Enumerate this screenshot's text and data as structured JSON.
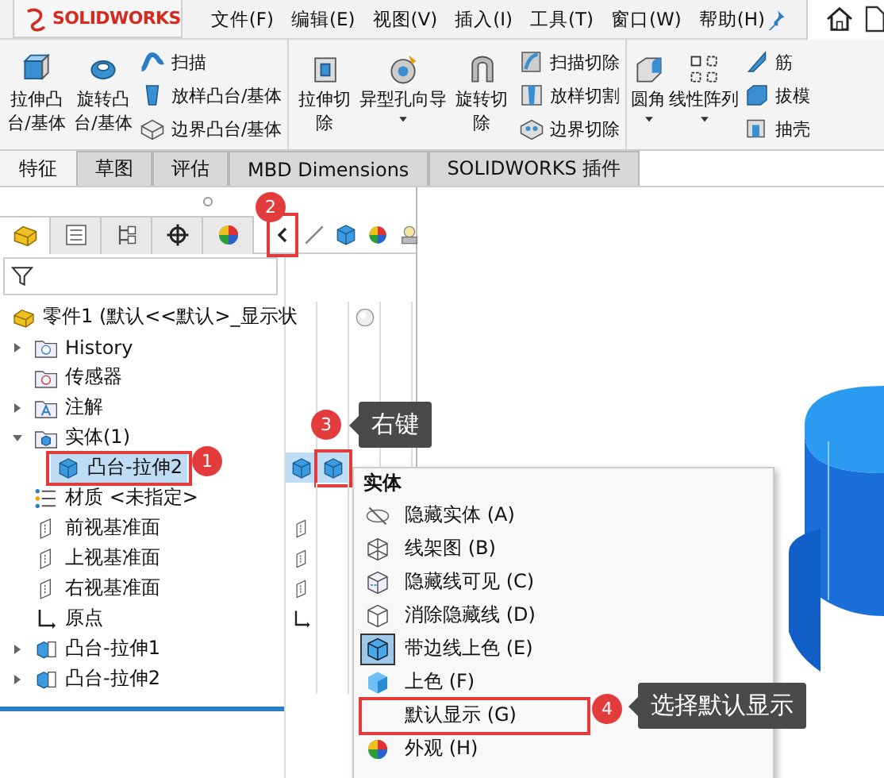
{
  "app": {
    "logo": "SOLIDWORKS"
  },
  "menu_bar": [
    {
      "label": "文件(F)"
    },
    {
      "label": "编辑(E)"
    },
    {
      "label": "视图(V)"
    },
    {
      "label": "插入(I)"
    },
    {
      "label": "工具(T)"
    },
    {
      "label": "窗口(W)"
    },
    {
      "label": "帮助(H)"
    }
  ],
  "toolbar": [
    {
      "items": [
        {
          "kind": "large",
          "label": "拉伸凸台/基体",
          "dropdown": false
        },
        {
          "kind": "large",
          "label": "旋转凸台/基体",
          "dropdown": false
        },
        {
          "kind": "stack",
          "items": [
            {
              "label": "扫描"
            },
            {
              "label": "放样凸台/基体"
            },
            {
              "label": "边界凸台/基体"
            }
          ]
        }
      ]
    },
    {
      "items": [
        {
          "kind": "large",
          "label": "拉伸切除",
          "dropdown": false
        },
        {
          "kind": "large",
          "label": "异型孔向导",
          "dropdown": true
        },
        {
          "kind": "large",
          "label": "旋转切除",
          "dropdown": false
        },
        {
          "kind": "stack",
          "items": [
            {
              "label": "扫描切除"
            },
            {
              "label": "放样切割"
            },
            {
              "label": "边界切除"
            }
          ]
        }
      ]
    },
    {
      "items": [
        {
          "kind": "large",
          "label": "圆角",
          "dropdown": true
        },
        {
          "kind": "large",
          "label": "线性阵列",
          "dropdown": true
        },
        {
          "kind": "stack",
          "items": [
            {
              "label": "筋"
            },
            {
              "label": "拔模"
            },
            {
              "label": "抽壳"
            }
          ]
        }
      ]
    }
  ],
  "tabs": [
    {
      "label": "特征",
      "selected": true
    },
    {
      "label": "草图",
      "selected": false
    },
    {
      "label": "评估",
      "selected": false
    },
    {
      "label": "MBD Dimensions",
      "selected": false
    },
    {
      "label": "SOLIDWORKS 插件",
      "selected": false
    }
  ],
  "panel_tabs": [
    {
      "selected": true
    },
    {
      "selected": false
    },
    {
      "selected": false
    },
    {
      "selected": false
    },
    {
      "selected": false
    }
  ],
  "tree": [
    {
      "kind": "part",
      "label": "零件1  (默认<<默认>_显示状"
    },
    {
      "kind": "history",
      "label": "History",
      "expanded": false
    },
    {
      "kind": "sensor",
      "label": "传感器"
    },
    {
      "kind": "annotation",
      "label": "注解",
      "expanded": false
    },
    {
      "kind": "bodies",
      "label": "实体(1)",
      "expanded": true,
      "children": [
        {
          "kind": "body",
          "label": "凸台-拉伸2",
          "selected": true
        }
      ]
    },
    {
      "kind": "material",
      "label": "材质 <未指定>"
    },
    {
      "kind": "plane",
      "label": "前视基准面"
    },
    {
      "kind": "plane",
      "label": "上视基准面"
    },
    {
      "kind": "plane",
      "label": "右视基准面"
    },
    {
      "kind": "origin",
      "label": "原点"
    },
    {
      "kind": "feature",
      "label": "凸台-拉伸1",
      "expanded": false
    },
    {
      "kind": "feature",
      "label": "凸台-拉伸2",
      "expanded": false
    }
  ],
  "context_menu": {
    "title": "实体",
    "items": [
      {
        "label": "隐藏实体 (A)",
        "selected": false
      },
      {
        "label": "线架图 (B)",
        "selected": false
      },
      {
        "label": "隐藏线可见 (C)",
        "selected": false
      },
      {
        "label": "消除隐藏线 (D)",
        "selected": false
      },
      {
        "label": "带边线上色 (E)",
        "selected": true
      },
      {
        "label": "上色 (F)",
        "selected": false
      },
      {
        "label": "默认显示 (G)",
        "selected": false
      },
      {
        "label": "外观 (H)",
        "selected": false
      }
    ]
  },
  "annotations": [
    {
      "number": "1"
    },
    {
      "number": "2"
    },
    {
      "number": "3",
      "callout": "右键"
    },
    {
      "number": "4",
      "callout": "选择默认显示"
    }
  ]
}
